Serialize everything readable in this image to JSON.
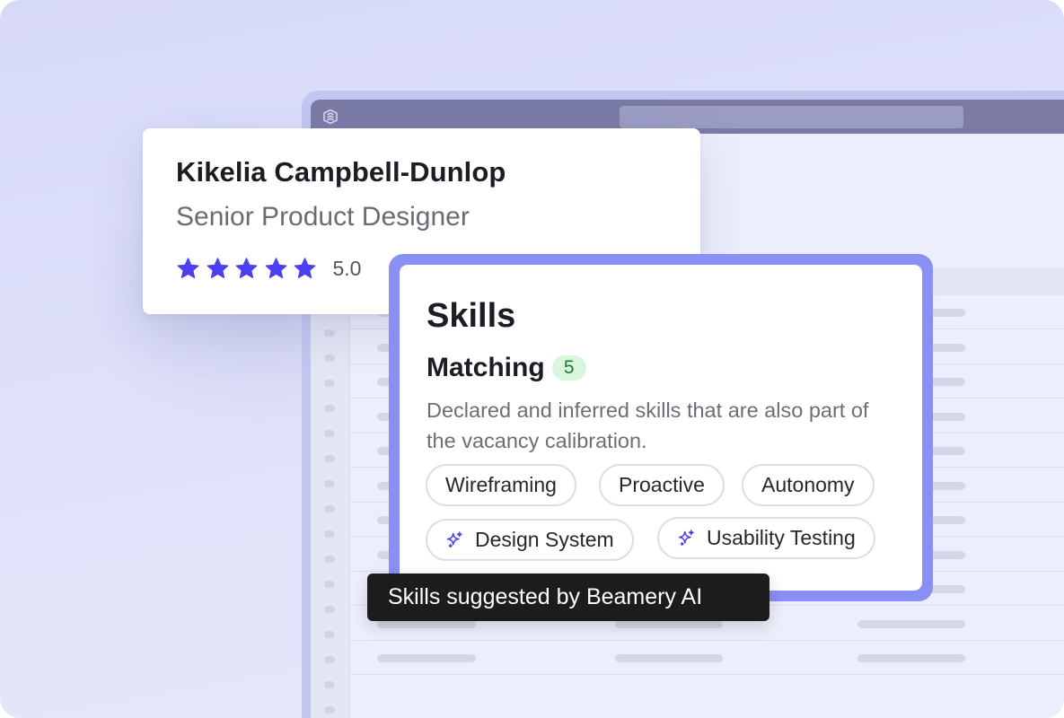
{
  "profile": {
    "name": "Kikelia Campbell-Dunlop",
    "role": "Senior Product Designer",
    "rating": 5.0,
    "rating_label": "5.0",
    "stars": 5
  },
  "skills": {
    "title": "Skills",
    "matching_title": "Matching",
    "matching_count": "5",
    "description": "Declared and inferred skills that are also part of the vacancy calibration.",
    "chips": [
      {
        "label": "Wireframing",
        "ai_suggested": false
      },
      {
        "label": "Proactive",
        "ai_suggested": false
      },
      {
        "label": "Autonomy",
        "ai_suggested": false
      },
      {
        "label": "Design System",
        "ai_suggested": true,
        "icon": "sparkle-icon"
      },
      {
        "label": "Usability Testing",
        "ai_suggested": true,
        "icon": "sparkle-icon"
      }
    ]
  },
  "tooltip": {
    "text": "Skills suggested by Beamery AI"
  },
  "colors": {
    "background": "#d7daf7",
    "accent": "#4c3ff0",
    "frame": "#8a8ff3",
    "badge_bg": "#d8f6dc",
    "badge_text": "#1f7a37",
    "tooltip_bg": "#1c1c1f"
  },
  "icons": {
    "app_logo": "beamery-logo-icon",
    "star": "star-icon",
    "sparkle": "sparkle-icon"
  }
}
